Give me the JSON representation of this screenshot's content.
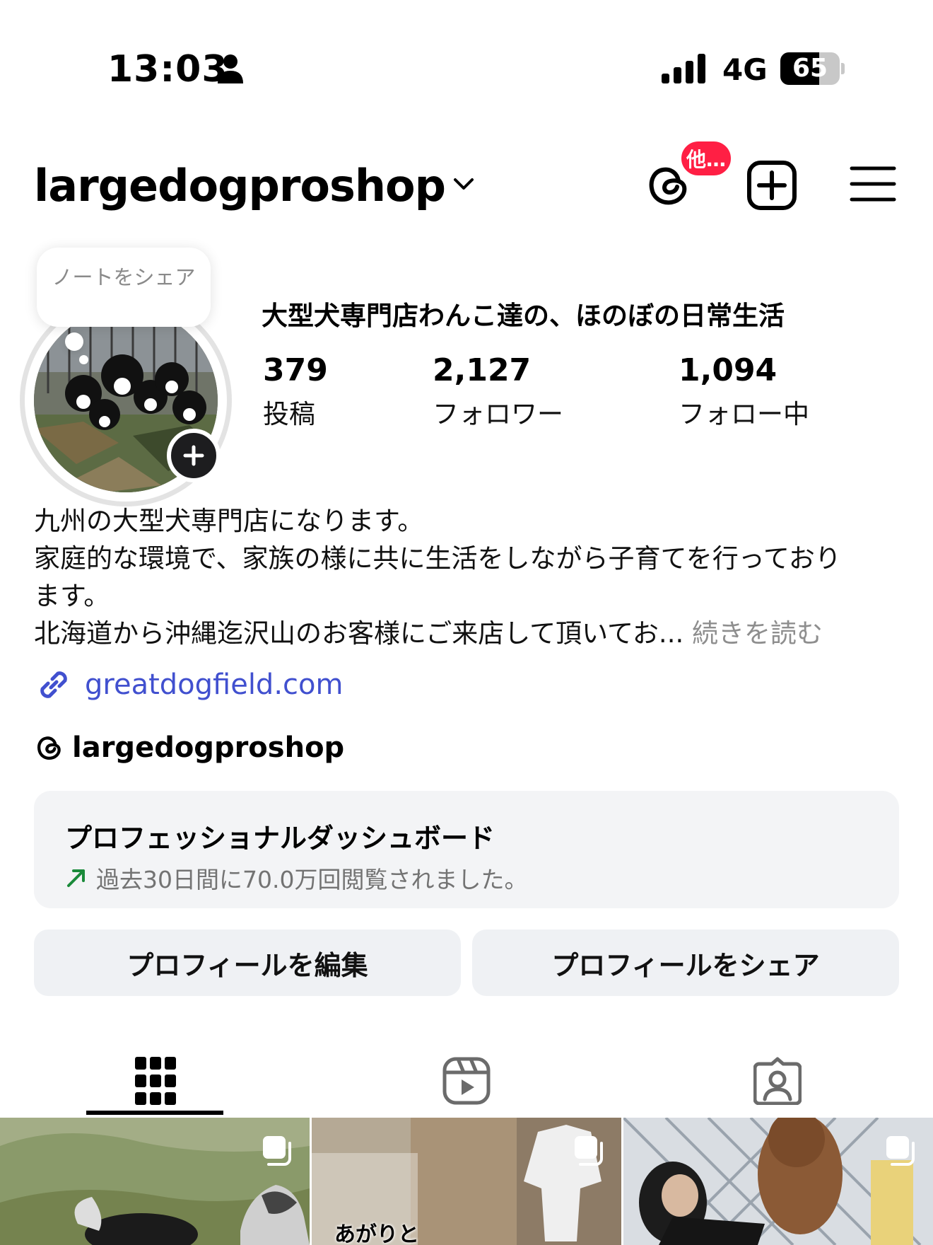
{
  "status_bar": {
    "time": "13:03",
    "network": "4G",
    "battery": "65",
    "battery_level": 0.65
  },
  "header": {
    "username": "largedogproshop",
    "threads_badge": "他…"
  },
  "note": {
    "placeholder": "ノートをシェア"
  },
  "profile": {
    "name": "大型犬専門店わんこ達の、ほのぼの日常生活",
    "stats": [
      {
        "value": "379",
        "label": "投稿"
      },
      {
        "value": "2,127",
        "label": "フォロワー"
      },
      {
        "value": "1,094",
        "label": "フォロー中"
      }
    ]
  },
  "bio": {
    "line1": "九州の大型犬専門店になります。",
    "line2": "家庭的な環境で、家族の様に共に生活をしながら子育てを行っており",
    "line3": "ます。",
    "line4": "北海道から沖縄迄沢山のお客様にご来店して頂いてお...",
    "more": "続きを読む"
  },
  "website": "greatdogfield.com",
  "threads_handle": "largedogproshop",
  "dashboard": {
    "title": "プロフェッショナルダッシュボード",
    "subtitle": "過去30日間に70.0万回閲覧されました。"
  },
  "buttons": {
    "edit_profile": "プロフィールを編集",
    "share_profile": "プロフィールをシェア"
  },
  "tabs": [
    {
      "name": "posts",
      "icon": "grid-icon",
      "active": true
    },
    {
      "name": "reels",
      "icon": "reels-icon",
      "active": false
    },
    {
      "name": "tagged",
      "icon": "tagged-icon",
      "active": false
    }
  ],
  "grid_posts": [
    {
      "icon": "multi-post-icon"
    },
    {
      "icon": "multi-post-icon",
      "overlay_text": "あがりと"
    },
    {
      "icon": "multi-post-icon"
    }
  ],
  "colors": {
    "link": "#4150cf",
    "badge": "#ff1f44",
    "trend": "#1a8a3a",
    "surface": "#f3f4f6"
  }
}
